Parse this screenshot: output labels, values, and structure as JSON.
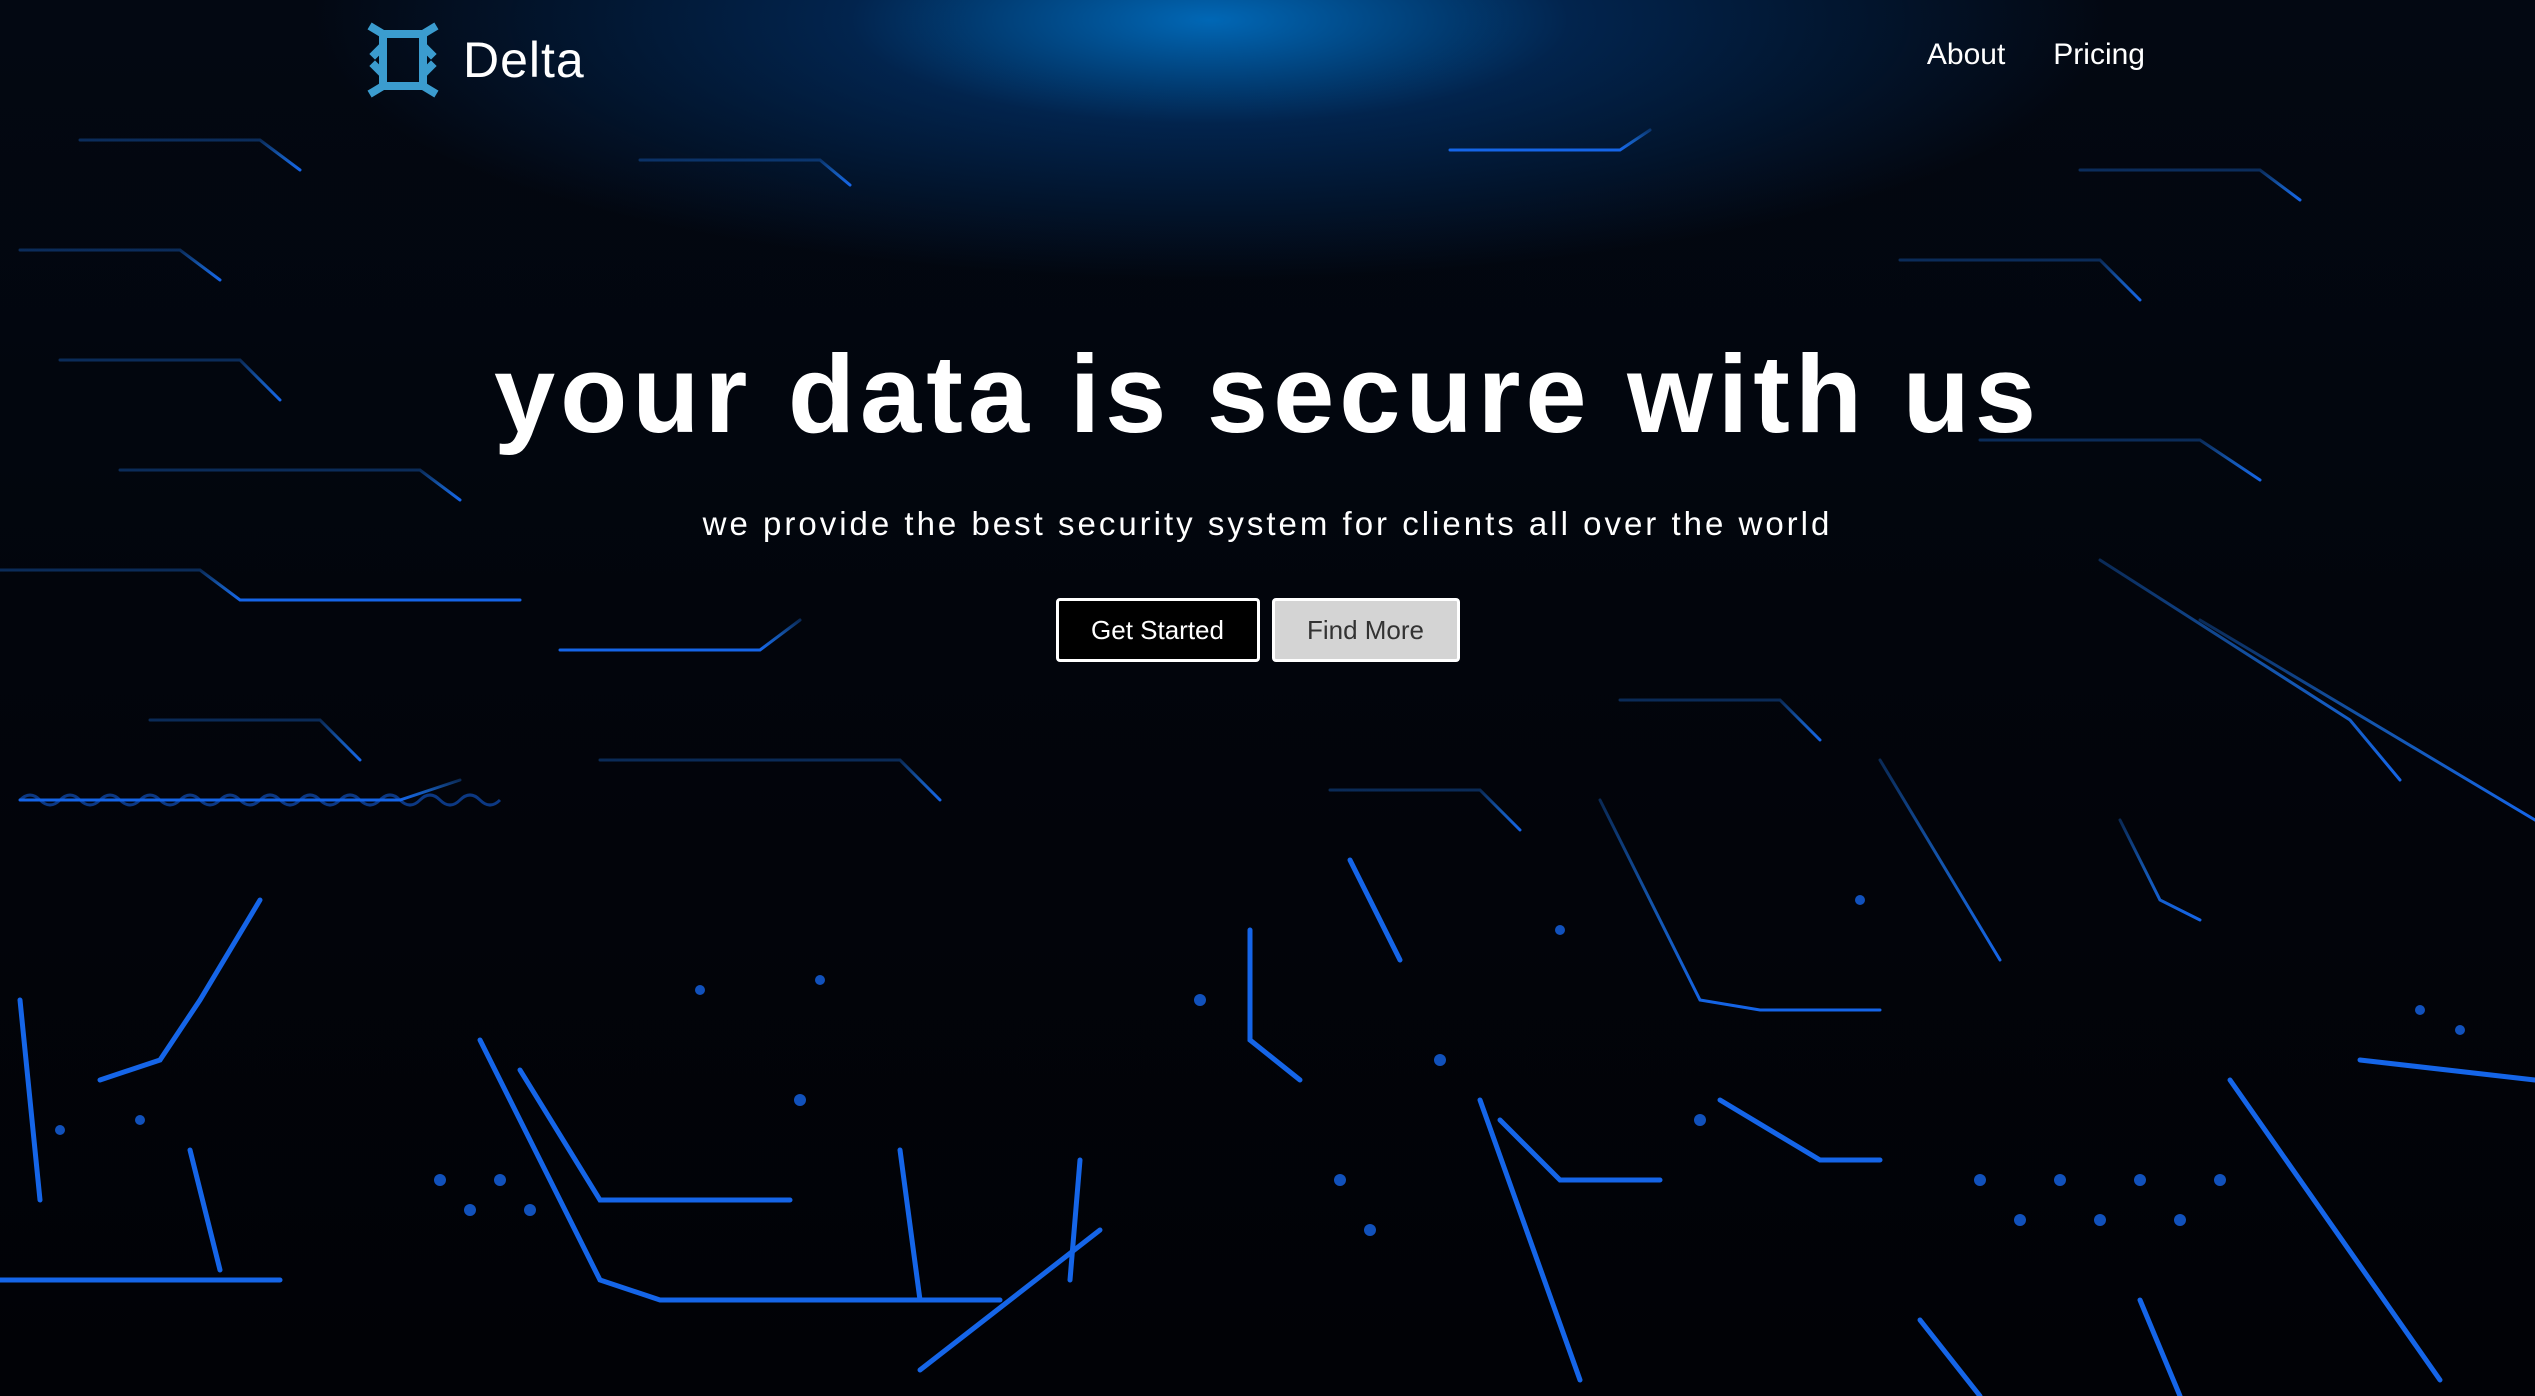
{
  "brand": {
    "name": "Delta",
    "logo_icon": "delta-logo-icon",
    "logo_color": "#3b9ccf"
  },
  "nav": {
    "links": [
      {
        "label": "About"
      },
      {
        "label": "Pricing"
      }
    ]
  },
  "hero": {
    "title": "your data is secure with us",
    "subtitle": "we provide the best security system for clients all over the world",
    "primary_button": "Get Started",
    "secondary_button": "Find More"
  },
  "theme": {
    "accent": "#1565e8",
    "glow": "#0078d2",
    "background": "#02040a"
  }
}
